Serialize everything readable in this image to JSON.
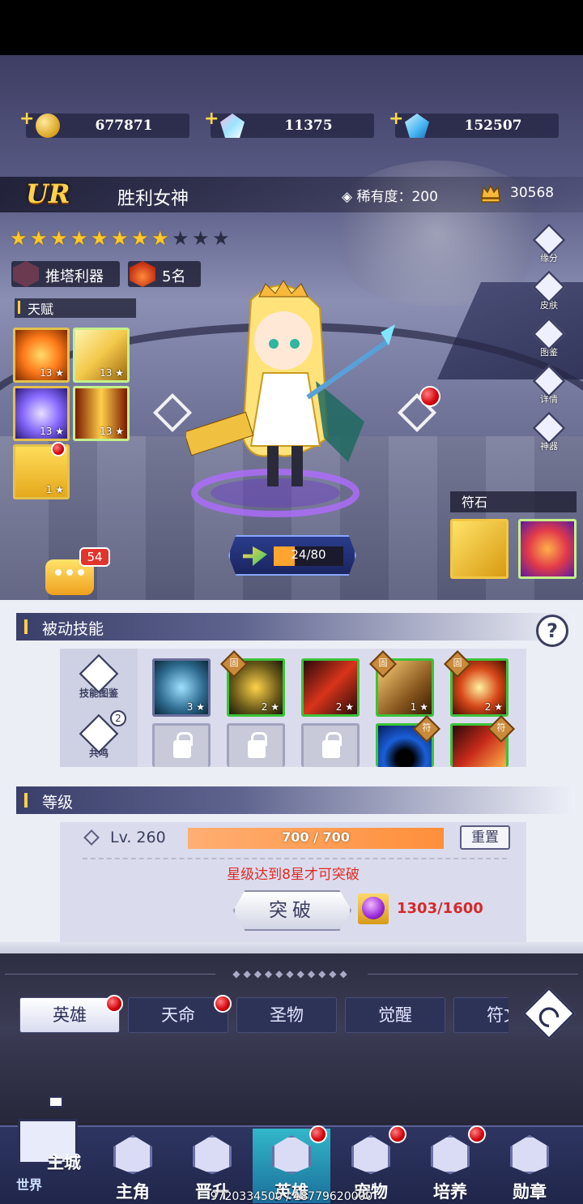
{
  "resources": [
    {
      "icon": "gold-coin-icon",
      "value": "677871"
    },
    {
      "icon": "rainbow-gem-icon",
      "value": "11375"
    },
    {
      "icon": "blue-diamond-icon",
      "value": "152507"
    }
  ],
  "hero": {
    "grade": "UR",
    "name": "胜利女神",
    "rarity_text": "稀有度：200",
    "power": "30568",
    "stars_total": 11,
    "stars_filled": 8,
    "tags": [
      {
        "label": "推塔利器",
        "icon": "tower-crossed-swords-icon"
      },
      {
        "label": "5名",
        "icon": "flame-rank-icon"
      }
    ]
  },
  "talent": {
    "title": "天赋",
    "items": [
      {
        "name": "talent-fire-slash",
        "level": "13",
        "color": "#ff7a1a"
      },
      {
        "name": "talent-golden-wing",
        "level": "13",
        "color": "#f4c84a"
      },
      {
        "name": "talent-purple-swirl",
        "level": "13",
        "color": "#8a6bff"
      },
      {
        "name": "talent-lightning-pillar",
        "level": "13",
        "color": "#ff5a1a"
      },
      {
        "name": "talent-mech-arm",
        "level": "1",
        "color": "#f1c13f"
      }
    ]
  },
  "side_menu": [
    {
      "label": "缘分",
      "icon": "heart-bond-icon"
    },
    {
      "label": "皮肤",
      "icon": "dress-skin-icon"
    },
    {
      "label": "图鉴",
      "icon": "book-icon"
    },
    {
      "label": "详情",
      "icon": "magnifier-icon"
    },
    {
      "label": "神器",
      "icon": "sword-artifact-icon"
    }
  ],
  "exp": {
    "text": "24/80",
    "current": 24,
    "max": 80
  },
  "chat": {
    "badge": "54"
  },
  "rune": {
    "title": "符石"
  },
  "passive": {
    "title": "被动技能",
    "help": "?",
    "side_buttons": [
      {
        "label": "技能图鉴",
        "icon": "skill-book-icon"
      },
      {
        "label": "共鸣",
        "icon": "resonance-icon",
        "badge": "2"
      }
    ],
    "skills": [
      {
        "level": "3",
        "fixed": false,
        "color": "#2d6a8e"
      },
      {
        "level": "2",
        "fixed": true,
        "color": "#6a5a1a"
      },
      {
        "level": "2",
        "fixed": false,
        "color": "#8a2020"
      },
      {
        "level": "1",
        "fixed": true,
        "color": "#8a5a20"
      },
      {
        "level": "2",
        "fixed": true,
        "color": "#d84a1a"
      }
    ],
    "fixed_label": "固",
    "rune_label": "符",
    "row2": [
      {
        "locked": true
      },
      {
        "locked": true
      },
      {
        "locked": true
      },
      {
        "locked": false,
        "rune": true,
        "color": "#1a5fd8"
      },
      {
        "locked": false,
        "rune": true,
        "color": "#c82a1a"
      }
    ]
  },
  "level": {
    "title": "等级",
    "lv_text": "Lv. 260",
    "exp_text": "700 / 700",
    "exp_current": 700,
    "exp_max": 700,
    "reset_label": "重置",
    "hint": "星级达到8星才可突破",
    "break_label": "突破",
    "cost": "1303/1600"
  },
  "sub_tabs": [
    {
      "label": "英雄",
      "active": true,
      "dot": true
    },
    {
      "label": "天命",
      "active": false,
      "dot": true
    },
    {
      "label": "圣物",
      "active": false,
      "dot": false
    },
    {
      "label": "觉醒",
      "active": false,
      "dot": false
    },
    {
      "label": "符文",
      "active": false,
      "dot": false
    }
  ],
  "nav": {
    "castle": {
      "label": "主城",
      "sub": "世界"
    },
    "items": [
      {
        "label": "主角",
        "icon": "protagonist-icon",
        "dot": false,
        "active": false
      },
      {
        "label": "晋升",
        "icon": "promotion-icon",
        "dot": false,
        "active": false
      },
      {
        "label": "英雄",
        "icon": "hero-helmet-icon",
        "dot": true,
        "active": true
      },
      {
        "label": "宠物",
        "icon": "pet-icon",
        "dot": true,
        "active": false
      },
      {
        "label": "培养",
        "icon": "cultivate-icon",
        "dot": true,
        "active": false
      },
      {
        "label": "勋章",
        "icon": "medal-icon",
        "dot": false,
        "active": false
      }
    ]
  },
  "footer": "9720334500 / 18779620000",
  "colors": {
    "gold": "#ffc82a",
    "accent_red": "#e12a23",
    "panel": "#eceef6",
    "nav": "#2e3561",
    "active_nav": "#32b7c9"
  }
}
